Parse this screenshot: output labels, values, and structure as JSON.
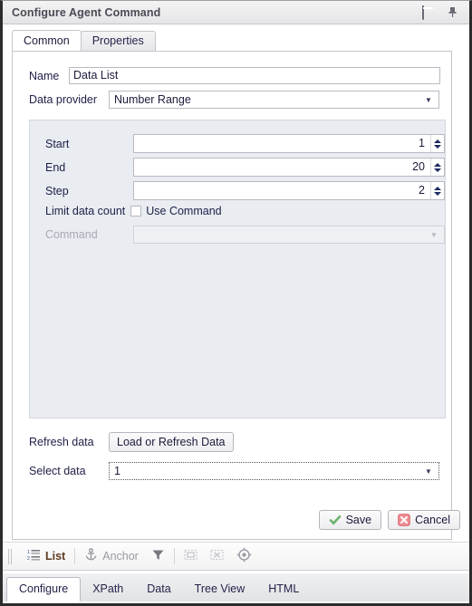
{
  "window": {
    "title": "Configure Agent Command",
    "restore_icon": "restore-icon",
    "pin_icon": "pin-icon"
  },
  "top_tabs": [
    {
      "label": "Common",
      "active": true
    },
    {
      "label": "Properties",
      "active": false
    }
  ],
  "form": {
    "name_label": "Name",
    "name_value": "Data List",
    "provider_label": "Data provider",
    "provider_value": "Number Range",
    "fields": [
      {
        "label": "Start",
        "value": "1"
      },
      {
        "label": "End",
        "value": "20"
      },
      {
        "label": "Step",
        "value": "2"
      }
    ],
    "limit_label": "Limit data count",
    "use_command_label": "Use Command",
    "use_command_checked": false,
    "command_label": "Command",
    "command_value": "",
    "command_disabled": true,
    "refresh_label": "Refresh data",
    "refresh_button": "Load or Refresh Data",
    "select_label": "Select data",
    "select_value": "1"
  },
  "footer": {
    "save_label": "Save",
    "cancel_label": "Cancel"
  },
  "toolbar": {
    "list_label": "List",
    "anchor_label": "Anchor",
    "icons": [
      "list-icon",
      "anchor-icon",
      "filter-icon",
      "select-box-icon",
      "deselect-box-icon",
      "target-icon"
    ]
  },
  "bottom_tabs": [
    {
      "label": "Configure",
      "active": true
    },
    {
      "label": "XPath",
      "active": false
    },
    {
      "label": "Data",
      "active": false
    },
    {
      "label": "Tree View",
      "active": false
    },
    {
      "label": "HTML",
      "active": false
    }
  ],
  "colors": {
    "accent": "#1e2a63",
    "save_green": "#6cb36c",
    "cancel_red": "#f08c90",
    "panel_bg": "#e9ecf1",
    "titlebar": "#ececed"
  }
}
